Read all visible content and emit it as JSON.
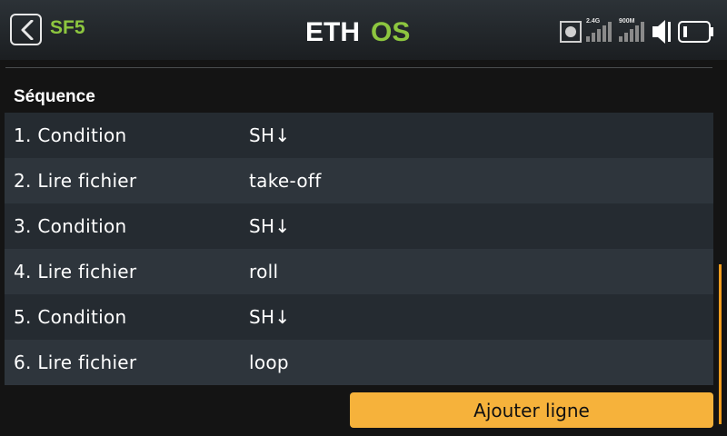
{
  "header": {
    "back_icon": "chevron-left-icon",
    "title": "SF5",
    "logo_text": "ETHOS",
    "logo_colors": {
      "eth": "#ffffff",
      "os": "#8dc63f"
    },
    "status": {
      "rx_24_label": "2.4G",
      "rx_900_label": "900M",
      "icons": [
        "record-icon",
        "signal-2.4g-icon",
        "signal-900m-icon",
        "volume-icon",
        "battery-icon"
      ]
    }
  },
  "section": {
    "title": "Séquence"
  },
  "sequence": [
    {
      "label": "1. Condition",
      "value": "SH↓"
    },
    {
      "label": "2. Lire fichier",
      "value": "take-off"
    },
    {
      "label": "3. Condition",
      "value": "SH↓"
    },
    {
      "label": "4. Lire fichier",
      "value": "roll"
    },
    {
      "label": "5. Condition",
      "value": "SH↓"
    },
    {
      "label": "6. Lire fichier",
      "value": "loop"
    }
  ],
  "add_button": {
    "label": "Ajouter ligne"
  },
  "colors": {
    "accent": "#f6b23b",
    "title_green": "#8dc63f",
    "scrollbar": "#f29e1f"
  }
}
